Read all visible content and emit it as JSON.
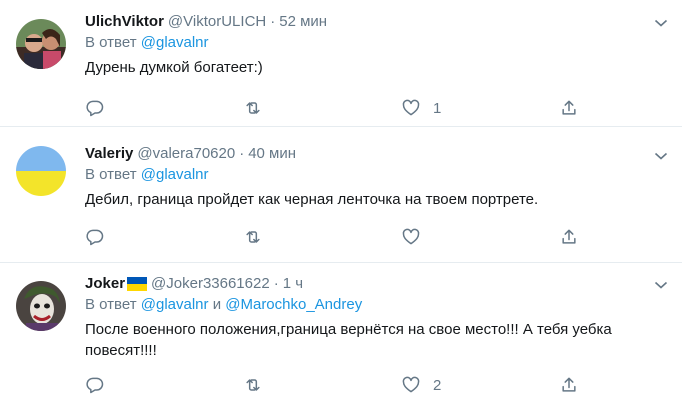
{
  "reply_prefix": "В ответ",
  "tweets": [
    {
      "name": "UlichViktor",
      "handle": "@ViktorULICH",
      "dot": "·",
      "time": "52 мин",
      "reply_to": [
        "@glavalnr"
      ],
      "reply_joiner": "",
      "text": "Дурень думкой богатеет:)",
      "likes": "1",
      "avatar_icon": "user-photo-avatar"
    },
    {
      "name": "Valeriy",
      "handle": "@valera70620",
      "dot": "·",
      "time": "40 мин",
      "reply_to": [
        "@glavalnr"
      ],
      "reply_joiner": "",
      "text": "Дебил, граница пройдет как черная ленточка на твоем портрете.",
      "likes": "",
      "avatar_icon": "ukraine-flag-avatar"
    },
    {
      "name": "Joker",
      "handle": "@Joker33661622",
      "dot": "·",
      "time": "1 ч",
      "reply_to": [
        "@glavalnr",
        "@Marochko_Andrey"
      ],
      "reply_joiner": "и",
      "text": "После военного положения,граница вернётся на свое место!!! А тебя уебка повесят!!!!",
      "likes": "2",
      "avatar_icon": "joker-avatar",
      "name_badge": "ukraine-flag-icon"
    }
  ],
  "colors": {
    "link": "#1b95e0",
    "muted": "#657786",
    "text": "#14171a",
    "divider": "#e6ecf0",
    "flag_blue": "#0057b7",
    "flag_yellow": "#ffd700"
  }
}
